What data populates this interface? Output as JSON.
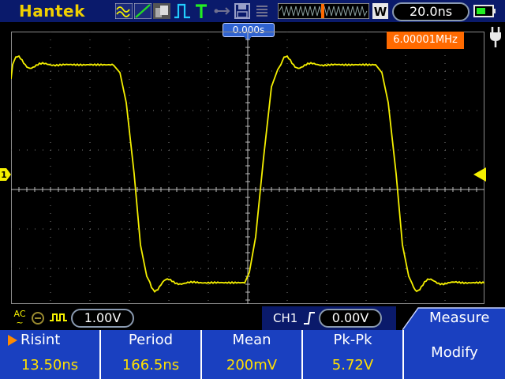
{
  "brand": "Hantek",
  "timebase": "20.0ns",
  "trigger_position": "0.000s",
  "frequency_readout": "6.00001MHz",
  "channel": {
    "label": "CH1",
    "coupling": "AC",
    "volts_per_div": "1.00V",
    "trigger_level": "0.00V",
    "marker": "1"
  },
  "menu_title": "Measure",
  "measurements": [
    {
      "label": "Risint",
      "value": "13.50ns",
      "selected": true
    },
    {
      "label": "Period",
      "value": "166.5ns"
    },
    {
      "label": "Mean",
      "value": "200mV"
    },
    {
      "label": "Pk-Pk",
      "value": "5.72V"
    }
  ],
  "modify_label": "Modify",
  "colors": {
    "trace": "#f5f000",
    "header_bg": "#0a1a6b",
    "menu_bg": "#1a40c0",
    "freq_badge": "#ff6a00",
    "brand": "#f0d000"
  },
  "icons": {
    "math": "wave-math-icon",
    "ramp": "ramp-icon",
    "roll": "roll-icon",
    "pulse": "pulse-icon",
    "trigger_t": "trigger-t-icon",
    "usb": "usb-icon",
    "save": "save-disk-icon",
    "menu": "menu-lines-icon",
    "window": "window-w-icon",
    "battery": "battery-icon",
    "plug": "power-plug-icon"
  }
}
